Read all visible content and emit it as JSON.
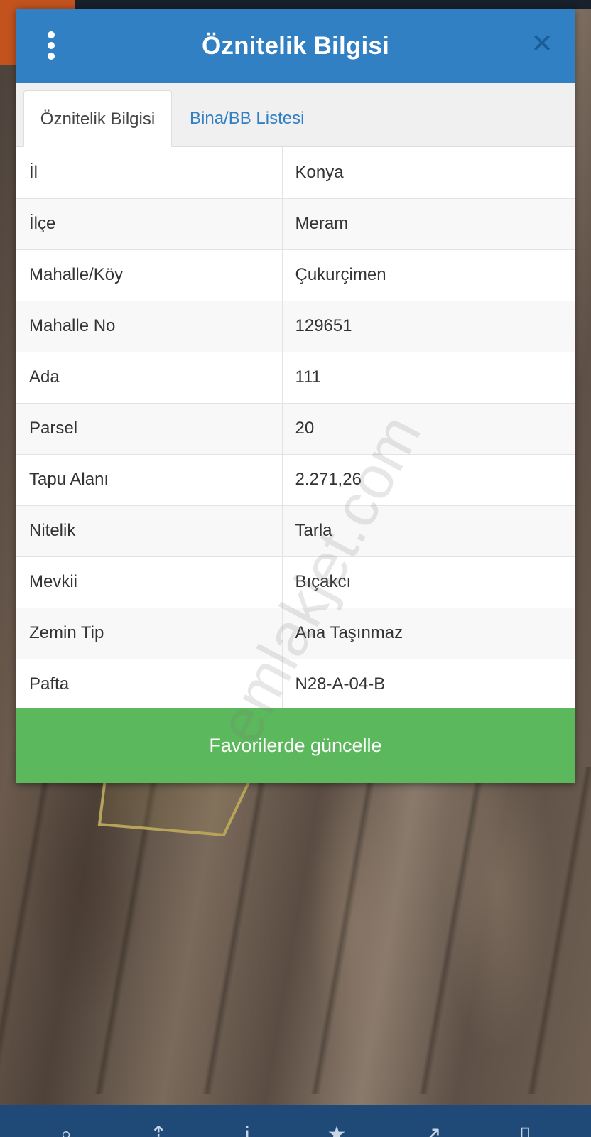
{
  "modal": {
    "title": "Öznitelik Bilgisi",
    "tabs": [
      {
        "label": "Öznitelik Bilgisi",
        "active": true
      },
      {
        "label": "Bina/BB Listesi",
        "active": false
      }
    ],
    "rows": [
      {
        "key": "İl",
        "value": "Konya"
      },
      {
        "key": "İlçe",
        "value": "Meram"
      },
      {
        "key": "Mahalle/Köy",
        "value": "Çukurçimen"
      },
      {
        "key": "Mahalle No",
        "value": "129651"
      },
      {
        "key": "Ada",
        "value": "111"
      },
      {
        "key": "Parsel",
        "value": "20"
      },
      {
        "key": "Tapu Alanı",
        "value": "2.271,26"
      },
      {
        "key": "Nitelik",
        "value": "Tarla"
      },
      {
        "key": "Mevkii",
        "value": "Bıçakcı"
      },
      {
        "key": "Zemin Tip",
        "value": "Ana Taşınmaz"
      },
      {
        "key": "Pafta",
        "value": "N28-A-04-B"
      }
    ],
    "action_button": "Favorilerde güncelle"
  },
  "watermark": "emlakjet.com",
  "icons": {
    "menu": "vertical-dots-icon",
    "close": "close-icon"
  },
  "colors": {
    "header": "#3180c4",
    "action_button": "#5cb85c",
    "tab_link": "#3180c4"
  }
}
